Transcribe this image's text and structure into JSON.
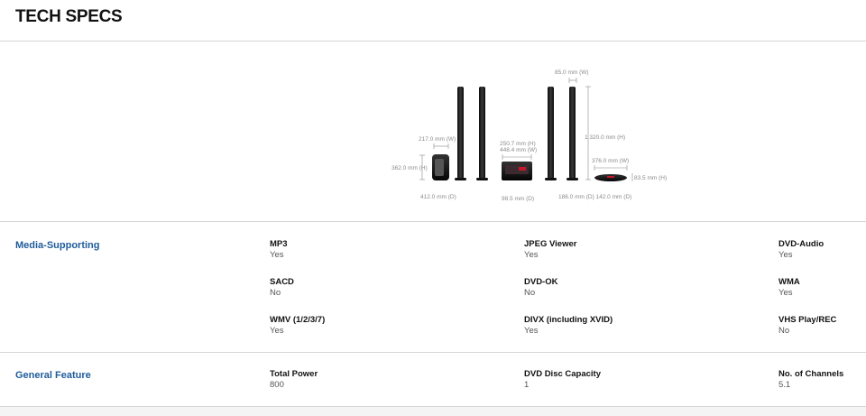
{
  "page": {
    "title": "TECH SPECS"
  },
  "diagram": {
    "labels": {
      "front_width": "217.0 mm (W)",
      "front_height": "362.0 mm (H)",
      "front_depth": "412.0 mm (D)",
      "main_height": "250.7 mm (H)",
      "main_width": "448.4 mm (W)",
      "main_depth": "98.5 mm (D)",
      "tower_width": "85.0 mm (W)",
      "tower_height": "1 320.0 mm (H)",
      "base_width": "376.0 mm (W)",
      "base_height": "83.5 mm (H)",
      "rear_depth": "186.0 mm (D) 142.0 mm (D)"
    }
  },
  "sections": [
    {
      "title": "Media-Supporting",
      "specs": [
        {
          "label": "MP3",
          "value": "Yes"
        },
        {
          "label": "JPEG Viewer",
          "value": "Yes"
        },
        {
          "label": "DVD-Audio",
          "value": "Yes"
        },
        {
          "label": "SACD",
          "value": "No"
        },
        {
          "label": "DVD-OK",
          "value": "No"
        },
        {
          "label": "WMA",
          "value": "Yes"
        },
        {
          "label": "WMV (1/2/3/7)",
          "value": "Yes"
        },
        {
          "label": "DIVX (including XVID)",
          "value": "Yes"
        },
        {
          "label": "VHS Play/REC",
          "value": "No"
        }
      ]
    },
    {
      "title": "General Feature",
      "specs": [
        {
          "label": "Total Power",
          "value": "800"
        },
        {
          "label": "DVD Disc Capacity",
          "value": "1"
        },
        {
          "label": "No. of Channels",
          "value": "5.1"
        }
      ]
    }
  ]
}
